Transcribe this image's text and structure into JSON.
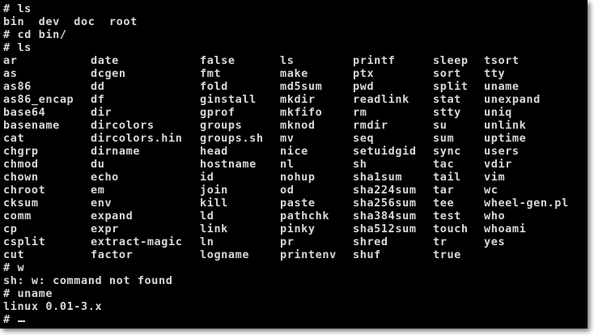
{
  "terminal": {
    "colors": {
      "background": "#000000",
      "foreground": "#d8d8d8"
    },
    "pre_lines": [
      "# ls",
      "bin  dev  doc  root",
      "# cd bin/",
      "# ls"
    ],
    "listing_rows": [
      [
        "ar",
        "date",
        "false",
        "ls",
        "printf",
        "sleep",
        "tsort"
      ],
      [
        "as",
        "dcgen",
        "fmt",
        "make",
        "ptx",
        "sort",
        "tty"
      ],
      [
        "as86",
        "dd",
        "fold",
        "md5sum",
        "pwd",
        "split",
        "uname"
      ],
      [
        "as86_encap",
        "df",
        "ginstall",
        "mkdir",
        "readlink",
        "stat",
        "unexpand"
      ],
      [
        "base64",
        "dir",
        "gprof",
        "mkfifo",
        "rm",
        "stty",
        "uniq"
      ],
      [
        "basename",
        "dircolors",
        "groups",
        "mknod",
        "rmdir",
        "su",
        "unlink"
      ],
      [
        "cat",
        "dircolors.hin",
        "groups.sh",
        "mv",
        "seq",
        "sum",
        "uptime"
      ],
      [
        "chgrp",
        "dirname",
        "head",
        "nice",
        "setuidgid",
        "sync",
        "users"
      ],
      [
        "chmod",
        "du",
        "hostname",
        "nl",
        "sh",
        "tac",
        "vdir"
      ],
      [
        "chown",
        "echo",
        "id",
        "nohup",
        "sha1sum",
        "tail",
        "vim"
      ],
      [
        "chroot",
        "em",
        "join",
        "od",
        "sha224sum",
        "tar",
        "wc"
      ],
      [
        "cksum",
        "env",
        "kill",
        "paste",
        "sha256sum",
        "tee",
        "wheel-gen.pl"
      ],
      [
        "comm",
        "expand",
        "ld",
        "pathchk",
        "sha384sum",
        "test",
        "who"
      ],
      [
        "cp",
        "expr",
        "link",
        "pinky",
        "sha512sum",
        "touch",
        "whoami"
      ],
      [
        "csplit",
        "extract-magic",
        "ln",
        "pr",
        "shred",
        "tr",
        "yes"
      ],
      [
        "cut",
        "factor",
        "logname",
        "printenv",
        "shuf",
        "true",
        ""
      ]
    ],
    "post_lines": [
      "# w",
      "sh: w: command not found",
      "# uname",
      "linux 0.01-3.x"
    ],
    "prompt": "#"
  }
}
